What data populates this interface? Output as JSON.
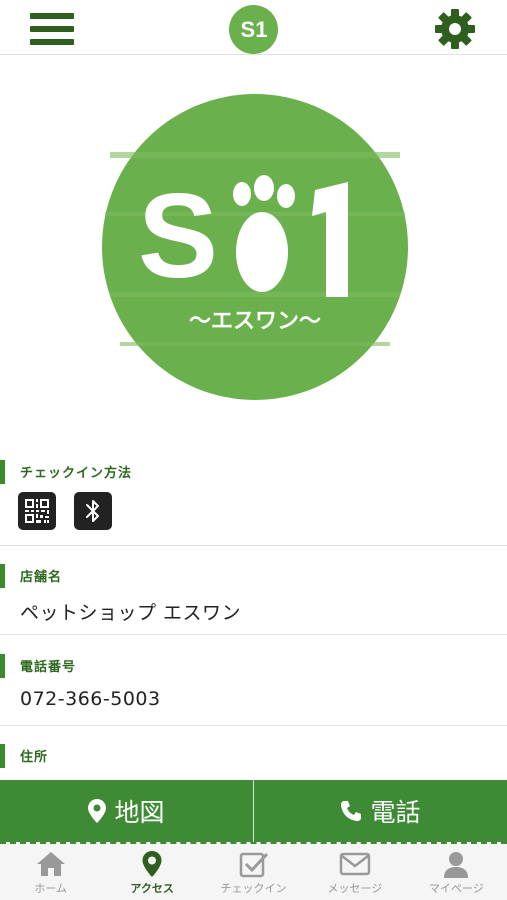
{
  "header": {
    "menu_icon": "hamburger-menu-icon",
    "logo_text": "S1",
    "settings_icon": "gear-icon"
  },
  "logo": {
    "main_text": "S1",
    "sub_text": "〜エスワン〜",
    "color": "#6ab04c"
  },
  "sections": {
    "checkin": {
      "label": "チェックイン方法",
      "icons": [
        "qr-code-icon",
        "bluetooth-icon"
      ]
    },
    "store": {
      "label": "店舗名",
      "value": "ペットショップ エスワン"
    },
    "phone": {
      "label": "電話番号",
      "value": "072-366-5003"
    },
    "address": {
      "label": "住所"
    }
  },
  "actions": {
    "map_label": "地図",
    "call_label": "電話"
  },
  "nav": {
    "items": [
      {
        "label": "ホーム",
        "icon": "home-icon"
      },
      {
        "label": "アクセス",
        "icon": "map-pin-icon",
        "active": true
      },
      {
        "label": "チェックイン",
        "icon": "checkin-icon"
      },
      {
        "label": "メッセージ",
        "icon": "envelope-icon"
      },
      {
        "label": "マイページ",
        "icon": "user-icon"
      }
    ]
  },
  "colors": {
    "accent": "#3e8a35",
    "dark_green": "#2f5f1e",
    "logo_green": "#6ab04c"
  }
}
